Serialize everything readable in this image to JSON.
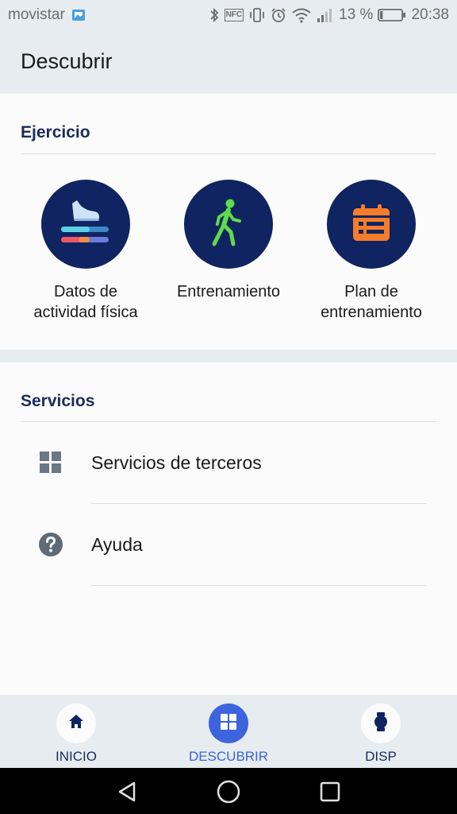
{
  "status_bar": {
    "carrier": "movistar",
    "nfc_label": "NFC",
    "battery_percent": "13 %",
    "battery_level": 0.13,
    "time": "20:38",
    "icons": [
      "gallery-notification-icon",
      "bluetooth-icon",
      "nfc-icon",
      "vibrate-icon",
      "alarm-icon",
      "wifi-icon",
      "signal-icon",
      "battery-icon"
    ]
  },
  "app_bar": {
    "title": "Descubrir"
  },
  "exercise": {
    "title": "Ejercicio",
    "tiles": [
      {
        "label": "Datos de\nactividad física",
        "icon": "shoe-activity-icon"
      },
      {
        "label": "Entrenamiento",
        "icon": "walking-person-icon"
      },
      {
        "label": "Plan de\nentrenamiento",
        "icon": "calendar-plan-icon"
      }
    ]
  },
  "services": {
    "title": "Servicios",
    "items": [
      {
        "label": "Servicios de terceros",
        "icon": "grid-apps-icon"
      },
      {
        "label": "Ayuda",
        "icon": "help-icon"
      }
    ]
  },
  "bottom_nav": {
    "items": [
      {
        "label": "INICIO",
        "icon": "home-icon",
        "active": false
      },
      {
        "label": "DESCUBRIR",
        "icon": "grid-icon",
        "active": true
      },
      {
        "label": "DISP",
        "icon": "watch-icon",
        "active": false
      }
    ]
  },
  "colors": {
    "navy": "#0f2460",
    "heading": "#1b2b5c",
    "accent": "#3d63dd",
    "walker_green": "#5fdc4a",
    "calendar_orange": "#f57c2b",
    "background": "#e6ecef",
    "card": "#fbfbfb"
  }
}
